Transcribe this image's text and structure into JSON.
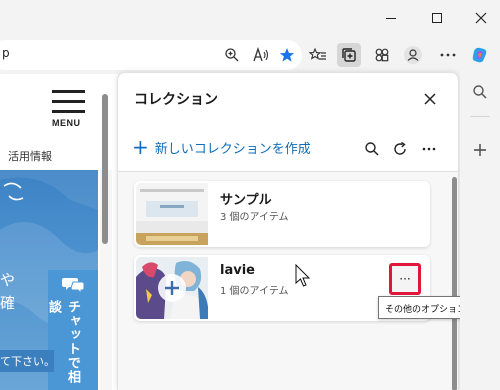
{
  "window": {
    "controls": [
      "minimize-icon",
      "maximize-icon",
      "close-icon"
    ]
  },
  "address_bar": {
    "url_fragment": "p"
  },
  "toolbar": {
    "icons": [
      "zoom-icon",
      "read-aloud-icon",
      "favorite-star-icon",
      "favorites-list-icon",
      "collections-icon",
      "extensions-icon",
      "profile-icon",
      "more-icon",
      "copilot-icon"
    ],
    "accent": "#0f6cbd"
  },
  "webpage": {
    "menu_label": "MENU",
    "nav_text": "活用情報",
    "hero_chars": [
      "や",
      "確"
    ],
    "chat_label": "チャットで相談",
    "footer_text": "て下さい。"
  },
  "panel": {
    "title": "コレクション",
    "new_collection_label": "新しいコレクションを作成",
    "tools": [
      "search-icon",
      "refresh-icon",
      "more-icon"
    ],
    "collections": [
      {
        "title": "サンプル",
        "count": "3 個のアイテム"
      },
      {
        "title": "lavie",
        "count": "1 個のアイテム"
      }
    ]
  },
  "tooltip": {
    "text": "その他のオプション メニュー",
    "button_glyph": "···",
    "highlight_color": "#e0173a"
  },
  "sidebar": {
    "icons": [
      "search-icon",
      "add-icon"
    ]
  }
}
